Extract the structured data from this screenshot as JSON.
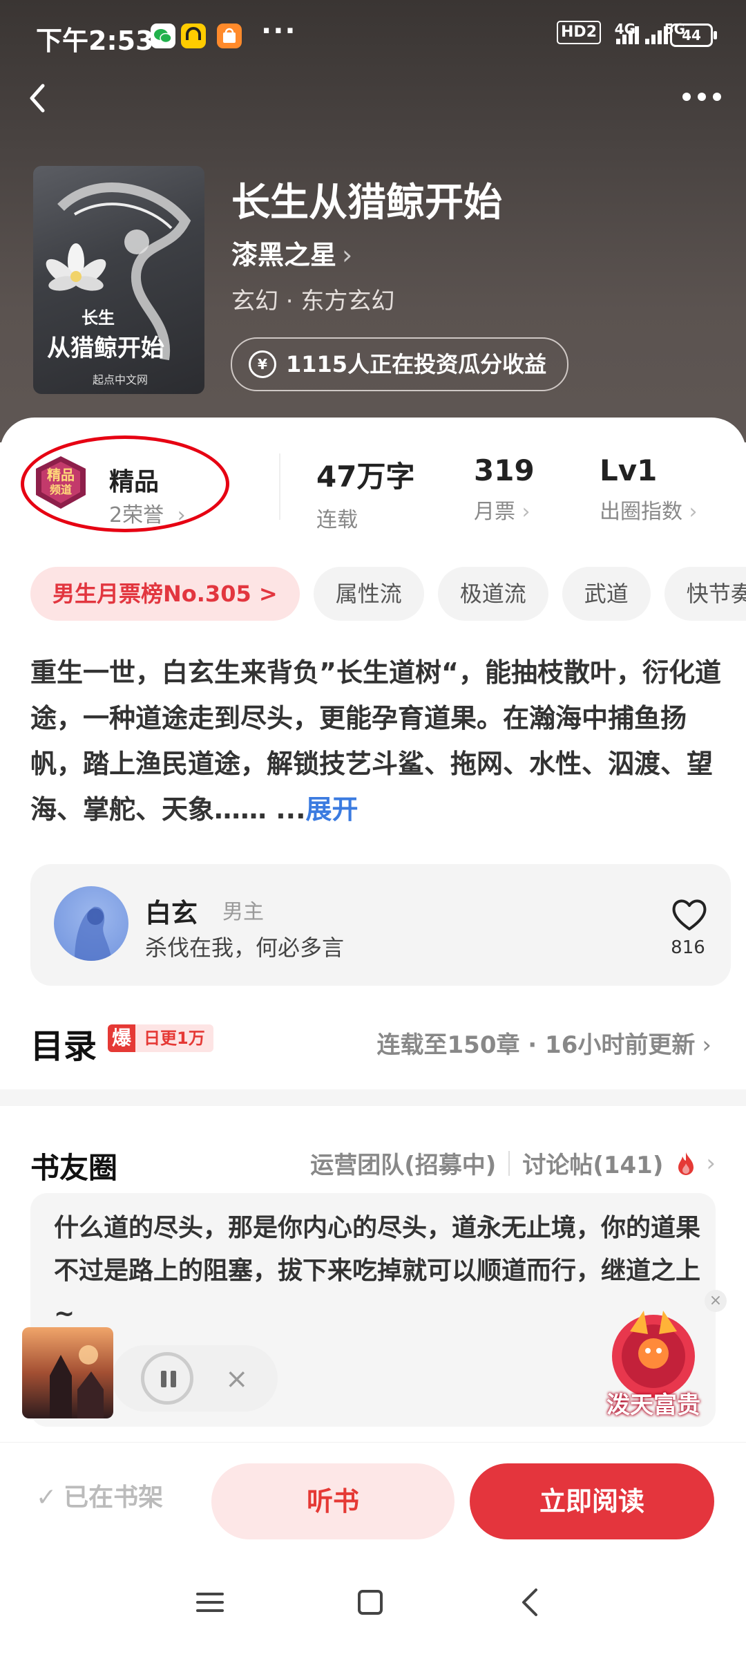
{
  "status_bar": {
    "time": "下午2:53",
    "dots": "···",
    "net": "HD2",
    "sig1": "4G",
    "sig2": "5G",
    "battery": "44"
  },
  "header": {
    "back_icon": "chevron-left-icon",
    "more_icon": "more-dots-icon"
  },
  "book": {
    "title": "长生从猎鲸开始",
    "author": "漆黑之星",
    "genre": "玄幻 · 东方玄幻",
    "invest_label": "1115人正在投资瓜分收益",
    "cover_small": "长生",
    "cover_big": "从猎鲸开始",
    "cover_publisher": "起点中文网"
  },
  "honor": {
    "title": "精品",
    "sub": "2荣誉"
  },
  "stats": [
    {
      "value": "47万字",
      "label": "连载"
    },
    {
      "value": "319",
      "label": "月票"
    },
    {
      "value": "Lv1",
      "label": "出圈指数"
    }
  ],
  "tags": [
    "男生月票榜No.305 >",
    "属性流",
    "极道流",
    "武道",
    "快节奏"
  ],
  "description": {
    "text": "重生一世，白玄生来背负”长生道树“，能抽枝散叶，衍化道途，一种道途走到尽头，更能孕育道果。在瀚海中捕鱼扬帆，踏上渔民道途，解锁技艺斗鲨、拖网、水性、泅渡、望海、掌舵、天象…… ...",
    "expand": "展开"
  },
  "character": {
    "name": "白玄",
    "role": "男主",
    "quote": "杀伐在我，何必多言",
    "likes": "816"
  },
  "toc": {
    "title": "目录",
    "badge_bao": "爆",
    "badge_daily": "日更1万",
    "status": "连载至150章 · 16小时前更新"
  },
  "community": {
    "title": "书友圈",
    "team": "运营团队(招募中)",
    "posts": "讨论帖(141)",
    "post_text": "什么道的尽头，那是你内心的尽头，道永无止境，你的道果不过是路上的阻塞，拔下来吃掉就可以顺道而行，继道之上 ~"
  },
  "promo": {
    "text": "泼天富贵"
  },
  "actions": {
    "shelf": "已在书架",
    "listen": "听书",
    "read": "立即阅读"
  },
  "colors": {
    "accent": "#e4353d",
    "link": "#3b7be0",
    "hero_bg": "#4a4442"
  }
}
